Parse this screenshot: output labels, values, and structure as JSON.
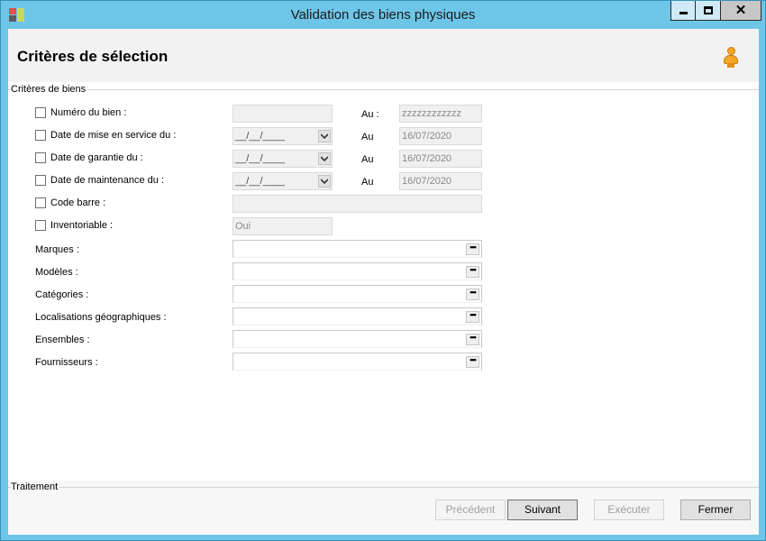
{
  "window": {
    "title": "Validation des biens physiques",
    "controls": {
      "minimize": "minimize",
      "maximize": "maximize",
      "close": "✕"
    }
  },
  "header": {
    "title": "Critères de sélection"
  },
  "criteria_group": {
    "title": "Critères de biens",
    "rows": [
      {
        "label": "Numéro du bien :",
        "from": "",
        "to_label": "Au :",
        "to": "zzzzzzzzzzzz"
      },
      {
        "label": "Date de mise en service du :",
        "from": "__/__/____",
        "to_label": "Au",
        "to": "16/07/2020"
      },
      {
        "label": "Date de garantie du :",
        "from": "__/__/____",
        "to_label": "Au",
        "to": "16/07/2020"
      },
      {
        "label": "Date de maintenance du :",
        "from": "__/__/____",
        "to_label": "Au",
        "to": "16/07/2020"
      },
      {
        "label": "Code barre :",
        "value": ""
      },
      {
        "label": "Inventoriable :",
        "value": "Oui"
      }
    ],
    "pickers": [
      {
        "label": "Marques :",
        "value": ""
      },
      {
        "label": "Modèles :",
        "value": ""
      },
      {
        "label": "Catégories :",
        "value": ""
      },
      {
        "label": "Localisations géographiques :",
        "value": ""
      },
      {
        "label": "Ensembles :",
        "value": ""
      },
      {
        "label": "Fournisseurs :",
        "value": ""
      }
    ],
    "ellipsis_label": "•••"
  },
  "treatment_group": {
    "title": "Traitement"
  },
  "buttons": {
    "previous": "Précédent",
    "next": "Suivant",
    "execute": "Exécuter",
    "close": "Fermer"
  },
  "colors": {
    "titlebar": "#6dc5e8",
    "header_bg": "#f2f2f2",
    "disabled_text": "#a0a0a0"
  }
}
